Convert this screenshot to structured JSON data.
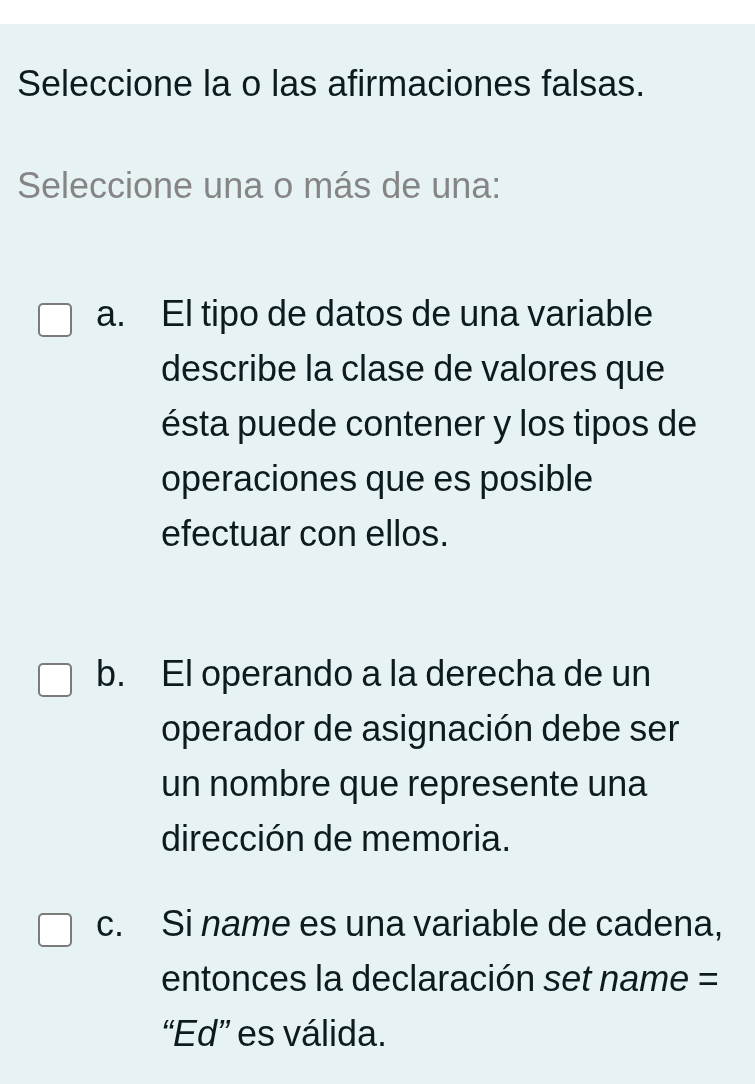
{
  "question": {
    "title": "Seleccione la o las afirmaciones falsas.",
    "instruction": "Seleccione una o más de una:"
  },
  "options": [
    {
      "letter": "a.",
      "text": "El tipo de datos de una variable describe la clase de valores que ésta puede contener y los tipos de operaciones que es posible efectuar con ellos.",
      "checked": false
    },
    {
      "letter": "b.",
      "text": "El operando a la derecha de un operador de asignación debe ser un nombre que represente una dirección de memoria.",
      "checked": false
    },
    {
      "letter": "c.",
      "text": "Si *name* es una variable de cadena, entonces la declaración *set name = “Ed”* es válida.",
      "checked": false
    }
  ]
}
